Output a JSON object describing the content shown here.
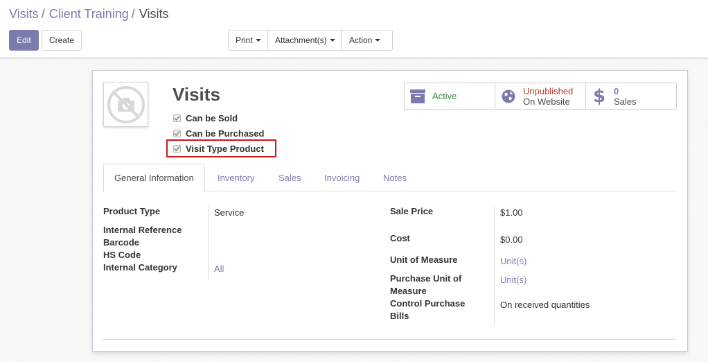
{
  "breadcrumb": {
    "item1": "Visits",
    "item2": "Client Training",
    "current": "Visits",
    "sep": "/"
  },
  "buttons": {
    "edit": "Edit",
    "create": "Create",
    "print": "Print",
    "attachments": "Attachment(s)",
    "action": "Action"
  },
  "product": {
    "name": "Visits",
    "checks": [
      {
        "label": "Can be Sold",
        "checked": true
      },
      {
        "label": "Can be Purchased",
        "checked": true
      },
      {
        "label": "Visit Type Product",
        "checked": true
      }
    ]
  },
  "smart_buttons": {
    "active": {
      "label": "Active",
      "icon": "archive-icon"
    },
    "website": {
      "line1": "Unpublished",
      "line2": "On Website",
      "icon": "globe-icon"
    },
    "sales": {
      "count": "0",
      "label": "Sales",
      "icon": "dollar-icon"
    }
  },
  "tabs": [
    "General Information",
    "Inventory",
    "Sales",
    "Invoicing",
    "Notes"
  ],
  "fields_left": {
    "product_type_label": "Product Type",
    "product_type_value": "Service",
    "internal_ref_label": "Internal Reference",
    "barcode_label": "Barcode",
    "hs_code_label": "HS Code",
    "internal_category_label": "Internal Category",
    "internal_category_value": "All"
  },
  "fields_right": {
    "sale_price_label": "Sale Price",
    "sale_price_value": "$1.00",
    "cost_label": "Cost",
    "cost_value": "$0.00",
    "uom_label": "Unit of Measure",
    "uom_value": "Unit(s)",
    "purchase_uom_label_1": "Purchase Unit of",
    "purchase_uom_label_2": "Measure",
    "purchase_uom_value": "Unit(s)",
    "control_label_1": "Control Purchase",
    "control_label_2": "Bills",
    "control_value": "On received quantities"
  },
  "colors": {
    "primary": "#7c7bad",
    "highlight": "#d0161c",
    "active": "#3b8c3b",
    "unpublished": "#c0392b"
  }
}
